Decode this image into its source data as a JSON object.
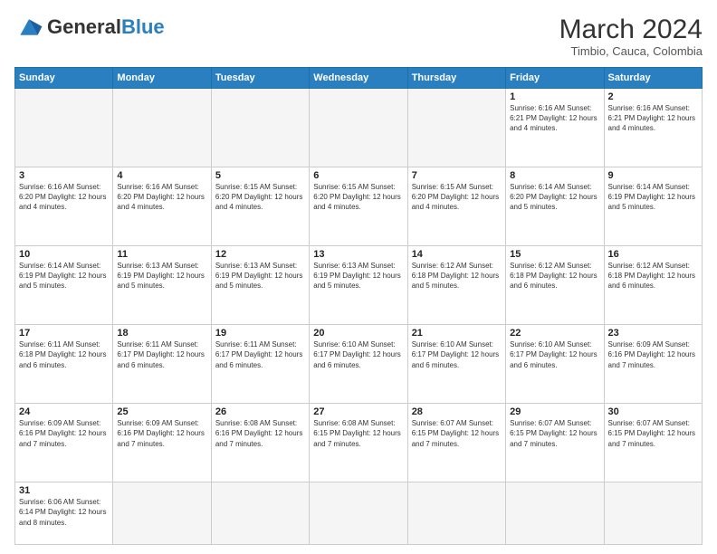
{
  "header": {
    "logo_general": "General",
    "logo_blue": "Blue",
    "month_year": "March 2024",
    "location": "Timbio, Cauca, Colombia"
  },
  "weekdays": [
    "Sunday",
    "Monday",
    "Tuesday",
    "Wednesday",
    "Thursday",
    "Friday",
    "Saturday"
  ],
  "weeks": [
    [
      {
        "day": "",
        "info": "",
        "empty": true
      },
      {
        "day": "",
        "info": "",
        "empty": true
      },
      {
        "day": "",
        "info": "",
        "empty": true
      },
      {
        "day": "",
        "info": "",
        "empty": true
      },
      {
        "day": "",
        "info": "",
        "empty": true
      },
      {
        "day": "1",
        "info": "Sunrise: 6:16 AM\nSunset: 6:21 PM\nDaylight: 12 hours\nand 4 minutes."
      },
      {
        "day": "2",
        "info": "Sunrise: 6:16 AM\nSunset: 6:21 PM\nDaylight: 12 hours\nand 4 minutes."
      }
    ],
    [
      {
        "day": "3",
        "info": "Sunrise: 6:16 AM\nSunset: 6:20 PM\nDaylight: 12 hours\nand 4 minutes."
      },
      {
        "day": "4",
        "info": "Sunrise: 6:16 AM\nSunset: 6:20 PM\nDaylight: 12 hours\nand 4 minutes."
      },
      {
        "day": "5",
        "info": "Sunrise: 6:15 AM\nSunset: 6:20 PM\nDaylight: 12 hours\nand 4 minutes."
      },
      {
        "day": "6",
        "info": "Sunrise: 6:15 AM\nSunset: 6:20 PM\nDaylight: 12 hours\nand 4 minutes."
      },
      {
        "day": "7",
        "info": "Sunrise: 6:15 AM\nSunset: 6:20 PM\nDaylight: 12 hours\nand 4 minutes."
      },
      {
        "day": "8",
        "info": "Sunrise: 6:14 AM\nSunset: 6:20 PM\nDaylight: 12 hours\nand 5 minutes."
      },
      {
        "day": "9",
        "info": "Sunrise: 6:14 AM\nSunset: 6:19 PM\nDaylight: 12 hours\nand 5 minutes."
      }
    ],
    [
      {
        "day": "10",
        "info": "Sunrise: 6:14 AM\nSunset: 6:19 PM\nDaylight: 12 hours\nand 5 minutes."
      },
      {
        "day": "11",
        "info": "Sunrise: 6:13 AM\nSunset: 6:19 PM\nDaylight: 12 hours\nand 5 minutes."
      },
      {
        "day": "12",
        "info": "Sunrise: 6:13 AM\nSunset: 6:19 PM\nDaylight: 12 hours\nand 5 minutes."
      },
      {
        "day": "13",
        "info": "Sunrise: 6:13 AM\nSunset: 6:19 PM\nDaylight: 12 hours\nand 5 minutes."
      },
      {
        "day": "14",
        "info": "Sunrise: 6:12 AM\nSunset: 6:18 PM\nDaylight: 12 hours\nand 5 minutes."
      },
      {
        "day": "15",
        "info": "Sunrise: 6:12 AM\nSunset: 6:18 PM\nDaylight: 12 hours\nand 6 minutes."
      },
      {
        "day": "16",
        "info": "Sunrise: 6:12 AM\nSunset: 6:18 PM\nDaylight: 12 hours\nand 6 minutes."
      }
    ],
    [
      {
        "day": "17",
        "info": "Sunrise: 6:11 AM\nSunset: 6:18 PM\nDaylight: 12 hours\nand 6 minutes."
      },
      {
        "day": "18",
        "info": "Sunrise: 6:11 AM\nSunset: 6:17 PM\nDaylight: 12 hours\nand 6 minutes."
      },
      {
        "day": "19",
        "info": "Sunrise: 6:11 AM\nSunset: 6:17 PM\nDaylight: 12 hours\nand 6 minutes."
      },
      {
        "day": "20",
        "info": "Sunrise: 6:10 AM\nSunset: 6:17 PM\nDaylight: 12 hours\nand 6 minutes."
      },
      {
        "day": "21",
        "info": "Sunrise: 6:10 AM\nSunset: 6:17 PM\nDaylight: 12 hours\nand 6 minutes."
      },
      {
        "day": "22",
        "info": "Sunrise: 6:10 AM\nSunset: 6:17 PM\nDaylight: 12 hours\nand 6 minutes."
      },
      {
        "day": "23",
        "info": "Sunrise: 6:09 AM\nSunset: 6:16 PM\nDaylight: 12 hours\nand 7 minutes."
      }
    ],
    [
      {
        "day": "24",
        "info": "Sunrise: 6:09 AM\nSunset: 6:16 PM\nDaylight: 12 hours\nand 7 minutes."
      },
      {
        "day": "25",
        "info": "Sunrise: 6:09 AM\nSunset: 6:16 PM\nDaylight: 12 hours\nand 7 minutes."
      },
      {
        "day": "26",
        "info": "Sunrise: 6:08 AM\nSunset: 6:16 PM\nDaylight: 12 hours\nand 7 minutes."
      },
      {
        "day": "27",
        "info": "Sunrise: 6:08 AM\nSunset: 6:15 PM\nDaylight: 12 hours\nand 7 minutes."
      },
      {
        "day": "28",
        "info": "Sunrise: 6:07 AM\nSunset: 6:15 PM\nDaylight: 12 hours\nand 7 minutes."
      },
      {
        "day": "29",
        "info": "Sunrise: 6:07 AM\nSunset: 6:15 PM\nDaylight: 12 hours\nand 7 minutes."
      },
      {
        "day": "30",
        "info": "Sunrise: 6:07 AM\nSunset: 6:15 PM\nDaylight: 12 hours\nand 7 minutes."
      }
    ],
    [
      {
        "day": "31",
        "info": "Sunrise: 6:06 AM\nSunset: 6:14 PM\nDaylight: 12 hours\nand 8 minutes."
      },
      {
        "day": "",
        "info": "",
        "empty": true
      },
      {
        "day": "",
        "info": "",
        "empty": true
      },
      {
        "day": "",
        "info": "",
        "empty": true
      },
      {
        "day": "",
        "info": "",
        "empty": true
      },
      {
        "day": "",
        "info": "",
        "empty": true
      },
      {
        "day": "",
        "info": "",
        "empty": true
      }
    ]
  ]
}
